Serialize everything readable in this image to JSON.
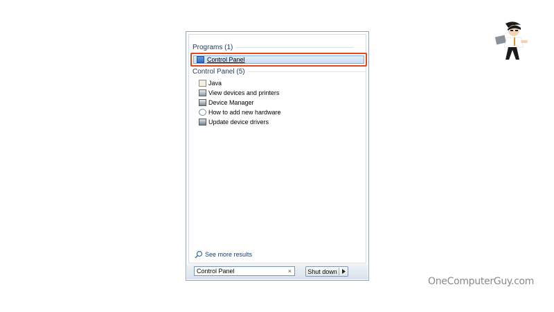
{
  "start_menu": {
    "programs_header": "Programs (1)",
    "highlighted_program": "Control Panel",
    "control_panel_header": "Control Panel (5)",
    "control_panel_items": [
      {
        "label": "Java",
        "icon": "java-icon"
      },
      {
        "label": "View devices and printers",
        "icon": "printer-icon"
      },
      {
        "label": "Device Manager",
        "icon": "device-manager-icon"
      },
      {
        "label": "How to add new hardware",
        "icon": "help-hardware-icon"
      },
      {
        "label": "Update device drivers",
        "icon": "driver-icon"
      }
    ],
    "see_more": "See more results",
    "search_value": "Control Panel",
    "clear_symbol": "×",
    "shutdown_label": "Shut down"
  },
  "watermark": "OneComputerGuy.com",
  "colors": {
    "highlight_border": "#e2471b",
    "header_text": "#1e395b",
    "link_text": "#0e3c8c",
    "watermark_text": "#8a8a8a"
  }
}
